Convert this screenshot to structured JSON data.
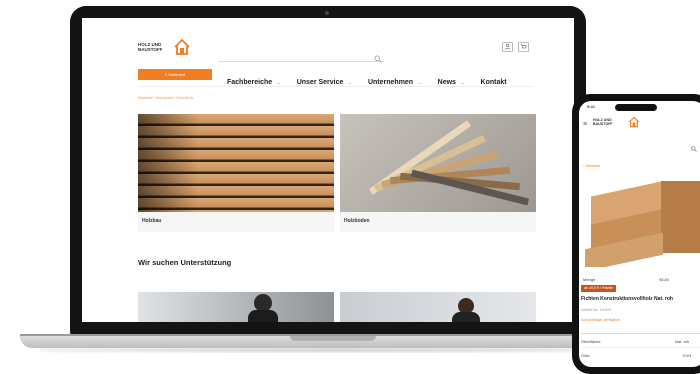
{
  "site": {
    "logo_text_line1": "HOLZ UND",
    "logo_text_line2": "BAUSTOFF",
    "search_icon": "search-icon",
    "header_icons": [
      "user-icon",
      "cart-icon"
    ]
  },
  "nav": {
    "sortiment_button": "≡ Sortiment",
    "items": [
      "Fachbereiche",
      "Unser Service",
      "Unternehmen",
      "News",
      "Kontakt"
    ],
    "caret": "⌄"
  },
  "breadcrumb": "Startseite  /  Holzhandel  /  Schnittholz",
  "cards": [
    {
      "caption": "Holzbau"
    },
    {
      "caption": "Holzboden"
    }
  ],
  "section_title": "Wir suchen Unterstützung",
  "phone": {
    "status_time": "9:41",
    "back_link": "‹ Holzbau",
    "menu_label": "Menge",
    "menu_value": "98,84",
    "price_badge": "ab 49,5 € / Palette",
    "product_title": "Fichten Konstruktionsvollholz Nat. roh",
    "product_meta": "Artikel-Nr. 10003",
    "availability": "Auf Anfrage verfügbar",
    "row1_label": "Oberfläche",
    "row1_value": "Nat. roh",
    "row2_label": "Güte",
    "row2_value": "KVH"
  },
  "colors": {
    "accent": "#ef7d22",
    "dark": "#141414"
  }
}
